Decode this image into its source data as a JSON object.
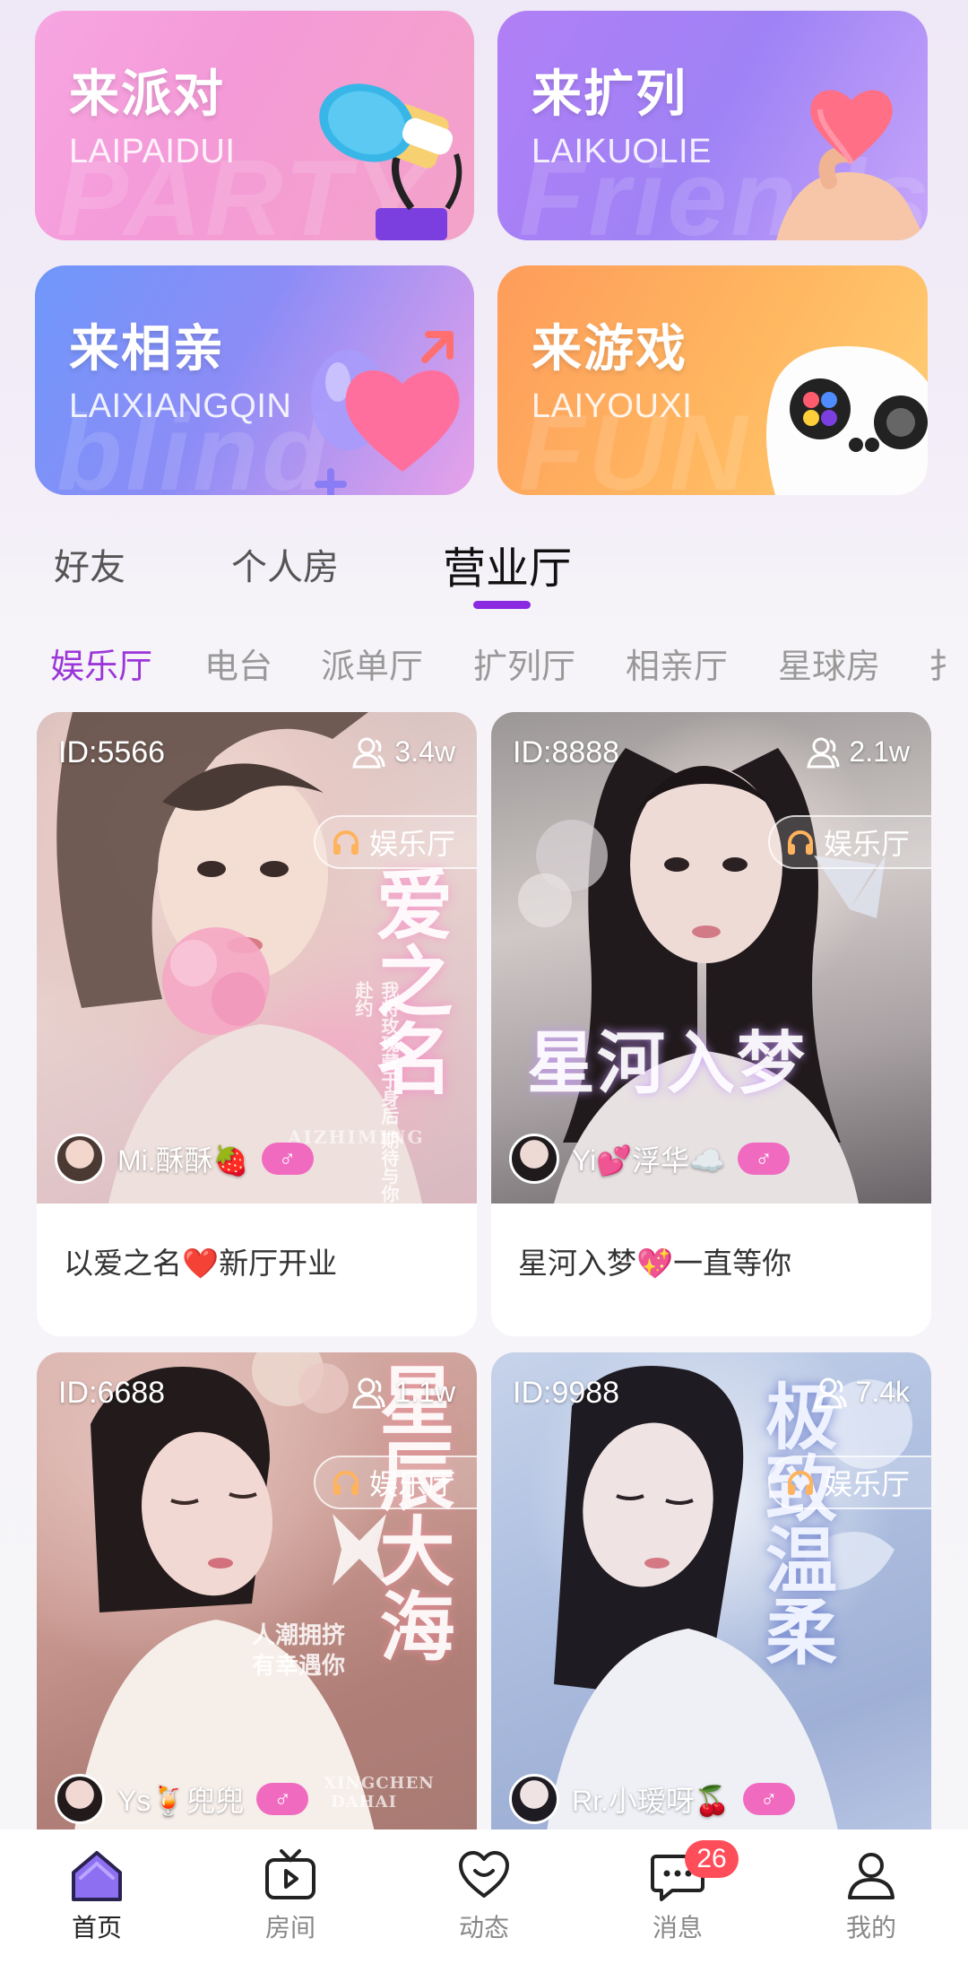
{
  "features": [
    {
      "title": "来派对",
      "pinyin": "LAIPAIDUI",
      "watermark": "PARTY"
    },
    {
      "title": "来扩列",
      "pinyin": "LAIKUOLIE",
      "watermark": "Friends"
    },
    {
      "title": "来相亲",
      "pinyin": "LAIXIANGQIN",
      "watermark": "blind"
    },
    {
      "title": "来游戏",
      "pinyin": "LAIYOUXI",
      "watermark": "FUN"
    }
  ],
  "main_tabs": [
    {
      "label": "好友"
    },
    {
      "label": "个人房"
    },
    {
      "label": "营业厅",
      "active": true
    }
  ],
  "categories": [
    "娱乐厅",
    "电台",
    "派单厅",
    "扩列厅",
    "相亲厅",
    "星球房",
    "扌"
  ],
  "rooms": [
    {
      "id": "ID:5566",
      "viewers": "3.4w",
      "tag": "娱乐厅",
      "host": "Mi.酥酥🍓",
      "desc": "以爱之名❤️新厅开业",
      "overlay": "爱之名",
      "overlay_sub": "AIZHIMING",
      "overlay_side": "我将玫瑰藏于身后 期待与你赴约"
    },
    {
      "id": "ID:8888",
      "viewers": "2.1w",
      "tag": "娱乐厅",
      "host": "Yi💕浮华☁️",
      "desc": "星河入梦💖一直等你",
      "overlay": "星河入梦"
    },
    {
      "id": "ID:6688",
      "viewers": "1.1w",
      "tag": "娱乐厅",
      "host": "Ys🍹兜兜",
      "overlay": "星辰大海",
      "overlay_sub": "人潮拥挤 有幸遇你",
      "overlay_en": "XINGCHEN DAHAI"
    },
    {
      "id": "ID:9988",
      "viewers": "7.4k",
      "tag": "娱乐厅",
      "host": "Rr.小瑷呀🍒",
      "overlay": "极致温柔"
    }
  ],
  "gender_symbol": "♂",
  "nav": [
    {
      "label": "首页",
      "icon": "home-icon",
      "active": true
    },
    {
      "label": "房间",
      "icon": "tv-icon"
    },
    {
      "label": "动态",
      "icon": "heart-chat-icon"
    },
    {
      "label": "消息",
      "icon": "message-icon",
      "badge": "26"
    },
    {
      "label": "我的",
      "icon": "profile-icon"
    }
  ],
  "colors": {
    "accent": "#8a2be2",
    "category_active": "#9b36d9",
    "gender_badge": "#f06bc0",
    "badge": "#ff4d5a"
  }
}
